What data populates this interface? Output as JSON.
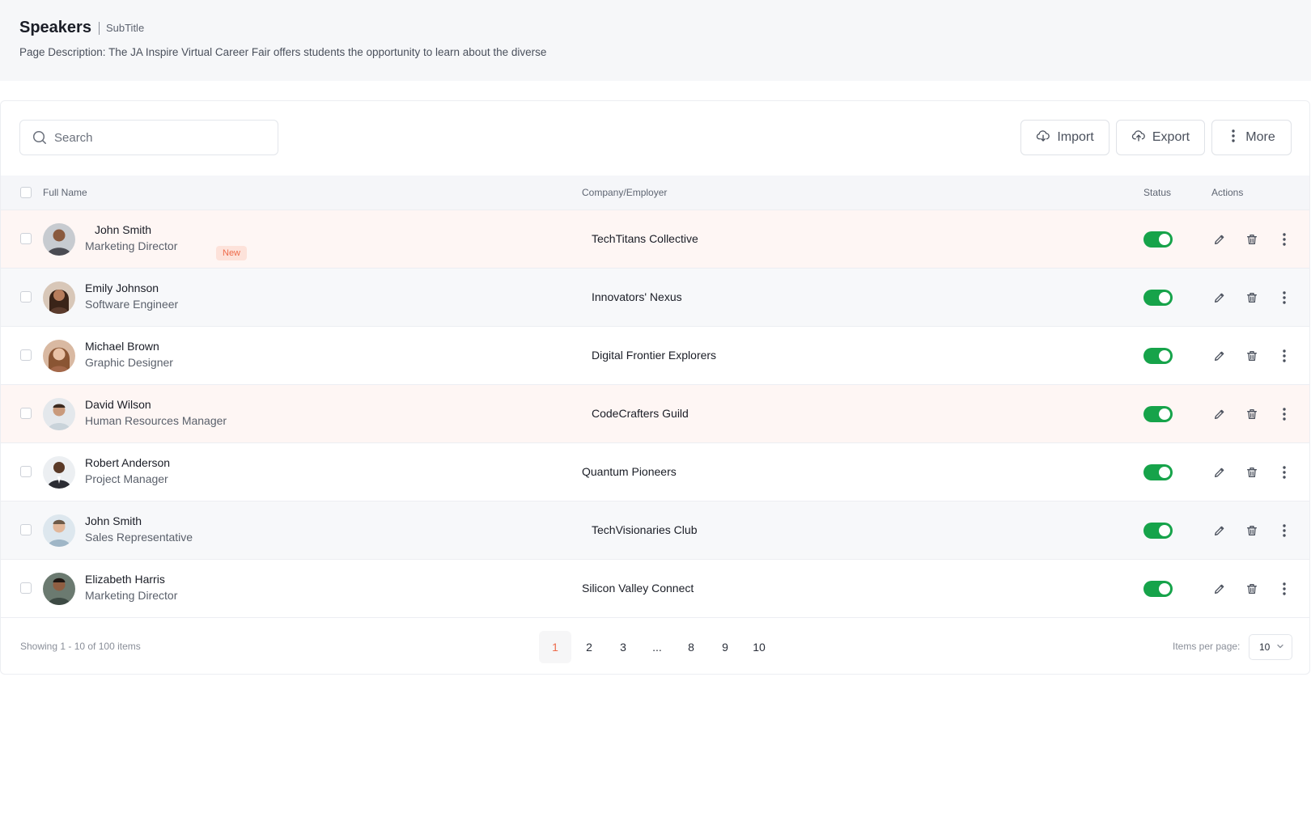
{
  "header": {
    "title": "Speakers",
    "subtitle": "SubTitle",
    "description": "Page Description: The JA Inspire Virtual Career Fair offers students the opportunity to learn about the diverse"
  },
  "toolbar": {
    "search_placeholder": "Search",
    "import_label": "Import",
    "export_label": "Export",
    "more_label": "More"
  },
  "table": {
    "columns": {
      "full_name": "Full Name",
      "company": "Company/Employer",
      "status": "Status",
      "actions": "Actions"
    },
    "rows": [
      {
        "name": "John Smith",
        "role": "Marketing Director",
        "company": "TechTitans Collective",
        "badge": "New",
        "status_on": true,
        "avatar_color": "#4a4b52"
      },
      {
        "name": "Emily Johnson",
        "role": "Software Engineer",
        "company": "Innovators' Nexus",
        "status_on": true,
        "avatar_color": "#5b3b2c"
      },
      {
        "name": "Michael Brown",
        "role": "Graphic Designer",
        "company": "Digital Frontier Explorers",
        "status_on": true,
        "avatar_color": "#a4684a"
      },
      {
        "name": "David Wilson",
        "role": "Human Resources Manager",
        "company": "CodeCrafters Guild",
        "status_on": true,
        "avatar_color": "#c9d3da"
      },
      {
        "name": "Robert Anderson",
        "role": "Project Manager",
        "company": "Quantum Pioneers",
        "status_on": true,
        "avatar_color": "#2b2c33"
      },
      {
        "name": "John Smith",
        "role": "Sales Representative",
        "company": "TechVisionaries Club",
        "status_on": true,
        "avatar_color": "#9fb6c7"
      },
      {
        "name": "Elizabeth Harris",
        "role": "Marketing Director",
        "company": "Silicon Valley Connect",
        "status_on": true,
        "avatar_color": "#3d4a44"
      }
    ]
  },
  "footer": {
    "showing": "Showing 1 - 10 of 100 items",
    "pages": [
      "1",
      "2",
      "3",
      "...",
      "8",
      "9",
      "10"
    ],
    "active_page": "1",
    "items_per_page_label": "Items per page:",
    "items_per_page_value": "10"
  },
  "colors": {
    "accent": "#ee6b4b",
    "toggle_on": "#16a34a"
  },
  "icons": {
    "search": "search-icon",
    "import": "cloud-download-icon",
    "export": "cloud-upload-icon",
    "more": "vertical-dots-icon",
    "edit": "pencil-icon",
    "delete": "trash-icon",
    "row_more": "vertical-dots-icon",
    "dropdown": "chevron-down-icon"
  }
}
